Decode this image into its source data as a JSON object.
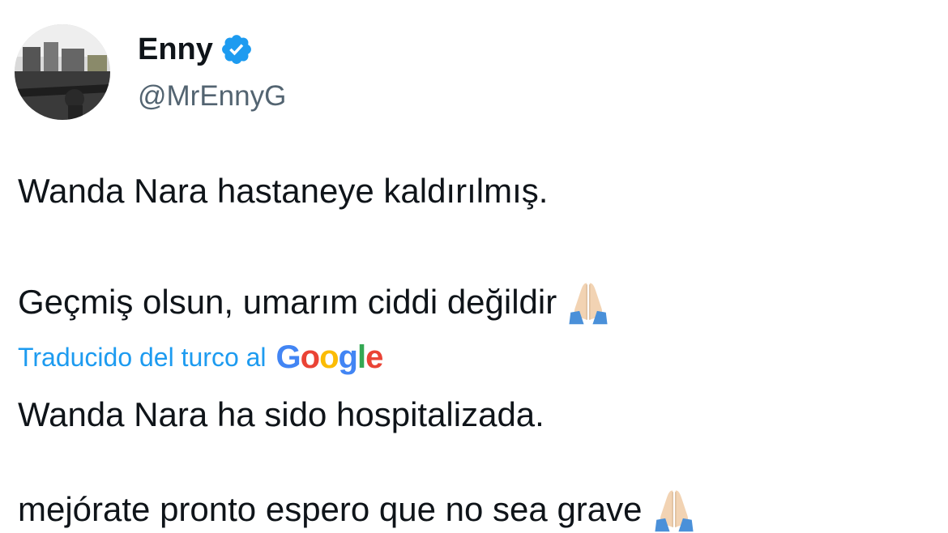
{
  "author": {
    "name": "Enny",
    "handle": "@MrEnnyG"
  },
  "tweet": {
    "original_line1": "Wanda Nara hastaneye kaldırılmış.",
    "original_line2": "Geçmiş olsun, umarım ciddi değildir",
    "translated_label": "Traducido del turco al",
    "translation_provider": "Google",
    "translated_line1": "Wanda Nara ha sido hospitalizada.",
    "translated_line2": "mejórate pronto espero que no sea grave"
  },
  "icons": {
    "verified": "verified-badge-icon",
    "pray": "folded-hands-emoji"
  },
  "colors": {
    "link": "#1d9bf0",
    "verified": "#1d9bf0",
    "secondary_text": "#536471"
  }
}
